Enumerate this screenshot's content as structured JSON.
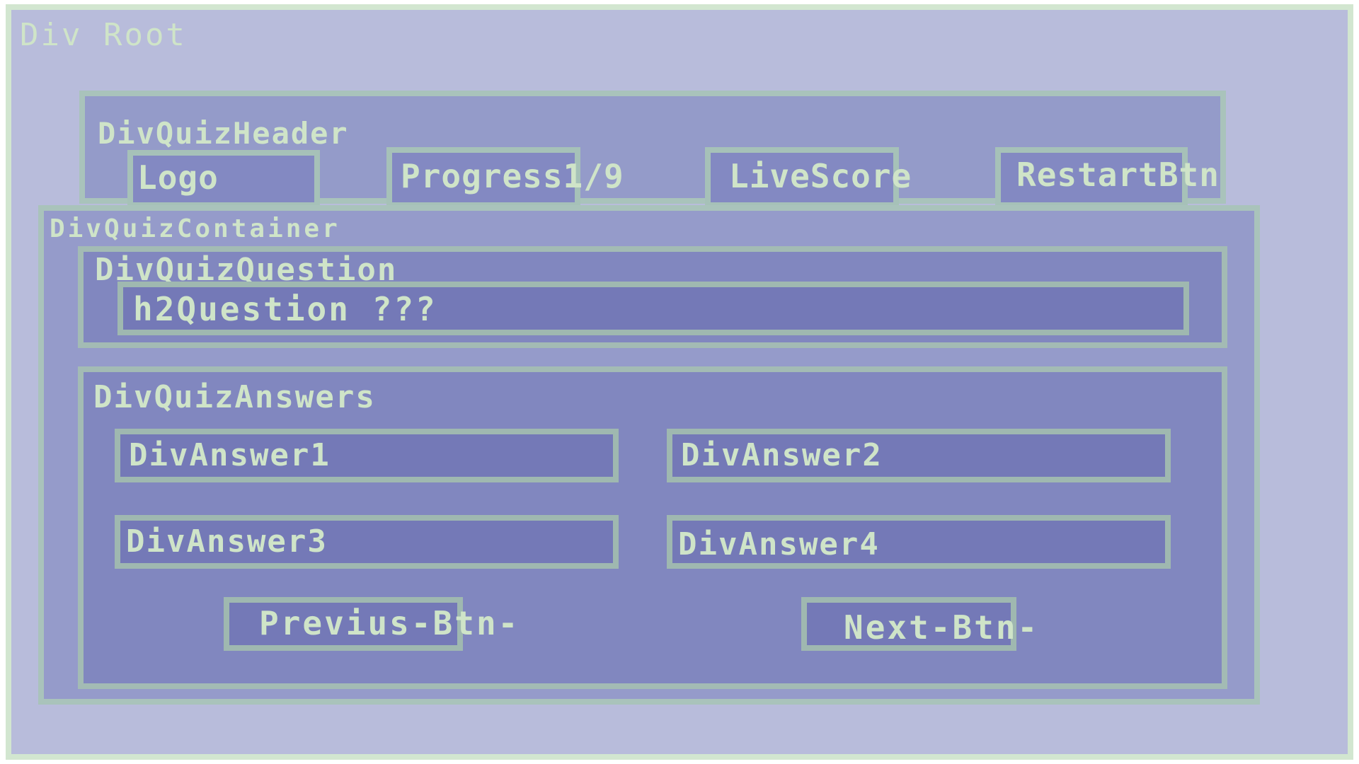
{
  "diagram": {
    "root": {
      "label": "Div Root"
    },
    "header": {
      "label": "DivQuizHeader",
      "logo": "Logo",
      "progress": "Progress1/9",
      "live_score": "LiveScore",
      "restart_button": "RestartBtn"
    },
    "container": {
      "label": "DivQuizContainer",
      "question": {
        "label": "DivQuizQuestion",
        "heading": "h2Question ???"
      },
      "answers": {
        "label": "DivQuizAnswers",
        "items": [
          "DivAnswer1",
          "DivAnswer2",
          "DivAnswer3",
          "DivAnswer4"
        ],
        "previous_button": "Previus-Btn-",
        "next_button": "Next-Btn-"
      }
    },
    "colors": {
      "border": "#a9c3bb",
      "label": "#cfe4c8",
      "root_fill": "#b8bcdb",
      "container_fill": "#959bca",
      "inner_fill": "#8187bf",
      "element_fill": "#7479b7"
    }
  }
}
